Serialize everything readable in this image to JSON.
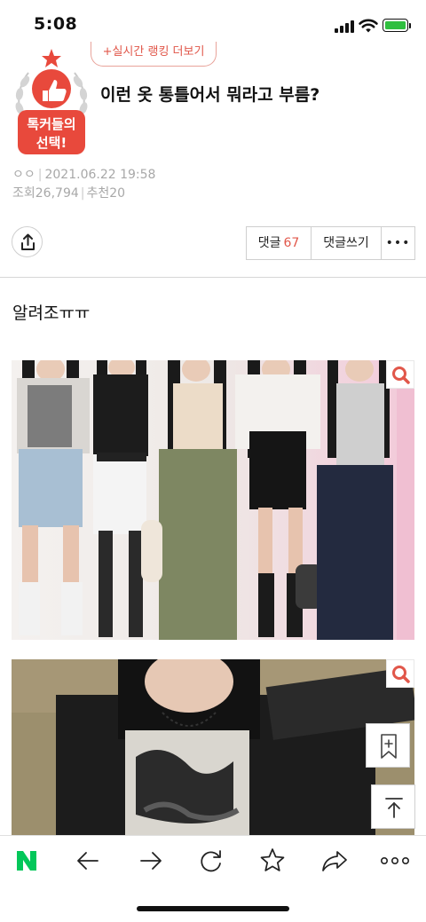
{
  "status_bar": {
    "time": "5:08"
  },
  "header": {
    "badge_text_line1": "톡커들의",
    "badge_text_line2": "선택!",
    "realtime_ranking_label": "+실시간 랭킹 더보기",
    "title": "이런 옷 통틀어서 뭐라고 부름?"
  },
  "meta": {
    "author": "ㅇㅇ",
    "datetime": "2021.06.22 19:58",
    "views_label": "조회",
    "views": "26,794",
    "recommend_label": "추천",
    "recommend": "20"
  },
  "actions": {
    "comments_label": "댓글",
    "comments_count": "67",
    "write_comment_label": "댓글쓰기",
    "more_label": "•••"
  },
  "body": {
    "text": "알려조ㅠㅠ"
  },
  "colors": {
    "accent": "#e1574a",
    "badge_red": "#e8493c",
    "naver_green": "#03c75a"
  },
  "icons": {
    "share": "share-icon",
    "zoom": "magnifier-icon",
    "bookmark": "bookmark-plus-icon",
    "top": "arrow-up-to-top-icon",
    "nav": [
      "naver-home-icon",
      "back-arrow-icon",
      "forward-arrow-icon",
      "refresh-icon",
      "star-icon",
      "share-arrow-icon",
      "more-dots-icon"
    ]
  }
}
